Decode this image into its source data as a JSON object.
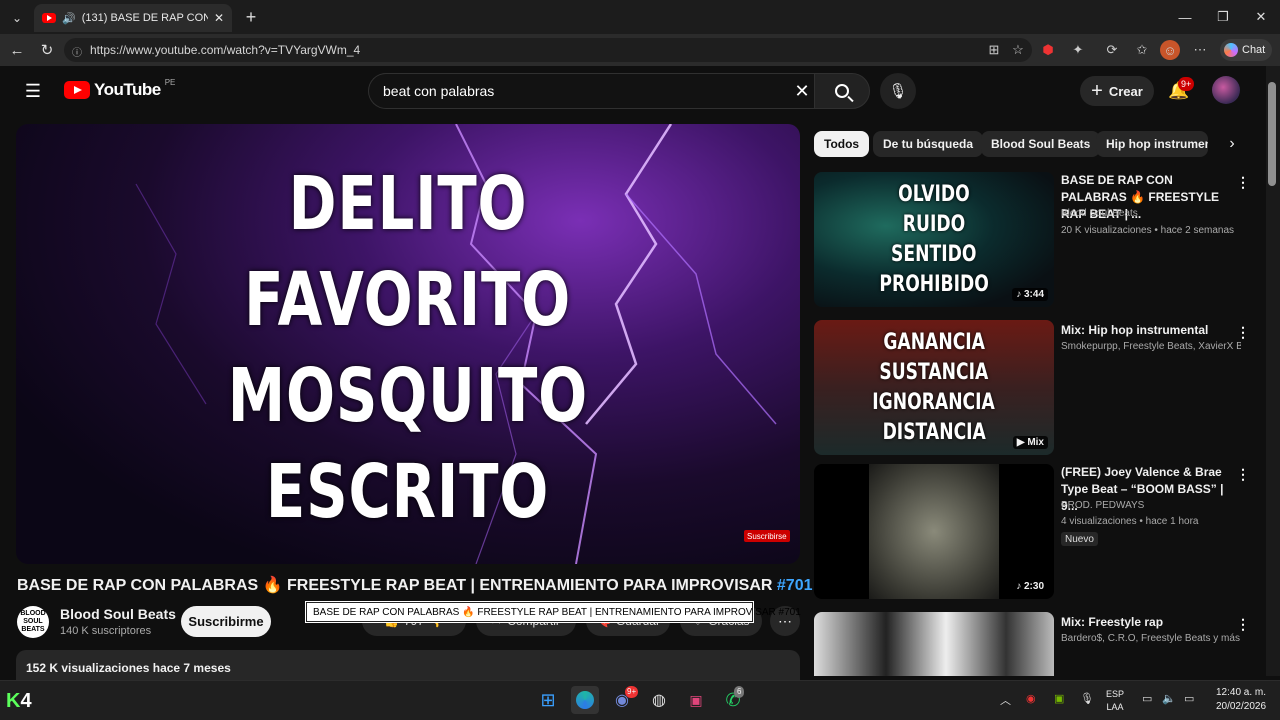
{
  "browser": {
    "tab_title": "(131) BASE DE RAP CON PALABRAS",
    "url": "https://www.youtube.com/watch?v=TVYargVWm_4",
    "chat_label": "Chat"
  },
  "header": {
    "logo_text": "YouTube",
    "country_code": "PE",
    "search_value": "beat con palabras",
    "create_label": "Crear",
    "notif_badge": "9+"
  },
  "player": {
    "lines": [
      "DELITO",
      "FAVORITO",
      "MOSQUITO",
      "ESCRITO"
    ],
    "watermark": "Suscribirse"
  },
  "video": {
    "title": "BASE DE RAP CON PALABRAS 🔥 FREESTYLE RAP BEAT | ENTRENAMIENTO PARA IMPROVISAR",
    "title_tag": "#701",
    "tooltip": "BASE DE RAP CON PALABRAS 🔥 FREESTYLE RAP BEAT | ENTRENAMIENTO PARA IMPROVISAR #701",
    "channel_name": "Blood Soul Beats",
    "channel_logo": "BLOOD SOUL BEATS",
    "subscribers": "140 K suscriptores",
    "subscribe_label": "Suscribirme",
    "likes": "797",
    "share_label": "Compartir",
    "save_label": "Guardar",
    "thanks_label": "Gracias",
    "views_line": "152 K visualizaciones  hace 7 meses"
  },
  "chips": [
    "Todos",
    "De tu búsqueda",
    "Blood Soul Beats",
    "Hip hop instrumental"
  ],
  "recommendations": [
    {
      "thumb_words": [
        "OLVIDO",
        "RUIDO",
        "SENTIDO",
        "PROHIBIDO"
      ],
      "duration": "3:44",
      "title": "BASE DE RAP CON PALABRAS 🔥 FREESTYLE RAP BEAT | ...",
      "channel": "Blood Soul Beats",
      "meta": "20 K visualizaciones • hace 2 semanas"
    },
    {
      "thumb_words": [
        "GANANCIA",
        "SUSTANCIA",
        "IGNORANCIA",
        "DISTANCIA"
      ],
      "duration": "Mix",
      "title": "Mix: Hip hop instrumental",
      "channel": "Smokepurpp, Freestyle Beats, XavierX Be..."
    },
    {
      "duration": "2:30",
      "title": "(FREE) Joey Valence & Brae Type Beat – “BOOM BASS” | 9...",
      "channel": "PROD. PEDWAYS",
      "meta": "4 visualizaciones • hace 1 hora",
      "badge": "Nuevo"
    },
    {
      "title": "Mix: Freestyle rap",
      "channel": "Bardero$, C.R.O, Freestyle Beats y más"
    }
  ],
  "taskbar": {
    "lang_top": "ESP",
    "lang_bottom": "LAA",
    "time": "12:40 a. m.",
    "date": "20/02/2026",
    "discord_badge": "9+",
    "whatsapp_badge": "6"
  },
  "colors": {
    "accent_blue": "#3ea6ff",
    "yt_red": "#ff0000",
    "bg": "#0f0f0f"
  }
}
